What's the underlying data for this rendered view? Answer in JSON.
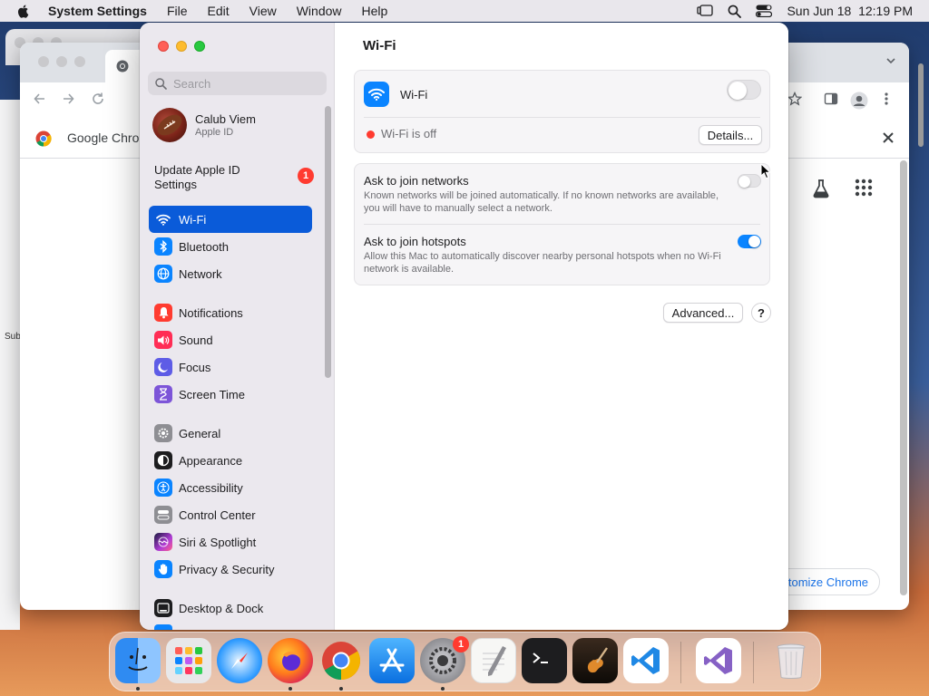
{
  "menubar": {
    "app_name": "System Settings",
    "menus": [
      "File",
      "Edit",
      "View",
      "Window",
      "Help"
    ],
    "clock": "Sun Jun 18  12:19 PM"
  },
  "chrome": {
    "infobar_text": "Google Chrom",
    "customize_text": "tomize Chrome",
    "left_sliver_text": "Sub"
  },
  "settings": {
    "search_placeholder": "Search",
    "account": {
      "name": "Calub Viem",
      "subtitle": "Apple ID"
    },
    "update": {
      "line1": "Update Apple ID",
      "line2": "Settings",
      "badge": "1"
    },
    "nav": [
      {
        "label": "Wi-Fi",
        "icon": "wifi-icon",
        "color": "#0a84ff",
        "selected": true
      },
      {
        "label": "Bluetooth",
        "icon": "bluetooth-icon",
        "color": "#0a84ff"
      },
      {
        "label": "Network",
        "icon": "globe-icon",
        "color": "#0a84ff"
      },
      {
        "label": "Notifications",
        "icon": "bell-icon",
        "color": "#ff3b30"
      },
      {
        "label": "Sound",
        "icon": "speaker-icon",
        "color": "#ff2d55"
      },
      {
        "label": "Focus",
        "icon": "moon-icon",
        "color": "#5e5ce6"
      },
      {
        "label": "Screen Time",
        "icon": "hourglass-icon",
        "color": "#7d55d8"
      },
      {
        "label": "General",
        "icon": "gear-icon",
        "color": "#8e8e93"
      },
      {
        "label": "Appearance",
        "icon": "appearance-icon",
        "color": "#1d1d1f"
      },
      {
        "label": "Accessibility",
        "icon": "accessibility-icon",
        "color": "#0a84ff"
      },
      {
        "label": "Control Center",
        "icon": "control-center-icon",
        "color": "#8e8e93"
      },
      {
        "label": "Siri & Spotlight",
        "icon": "siri-icon",
        "color": "#b03cd6"
      },
      {
        "label": "Privacy & Security",
        "icon": "hand-icon",
        "color": "#0a84ff"
      },
      {
        "label": "Desktop & Dock",
        "icon": "dock-icon",
        "color": "#1d1d1f"
      }
    ],
    "content": {
      "title": "Wi-Fi",
      "wifi_label": "Wi-Fi",
      "wifi_on": false,
      "status_text": "Wi-Fi is off",
      "details_button": "Details...",
      "ask_networks": {
        "title": "Ask to join networks",
        "description": "Known networks will be joined automatically. If no known networks are available, you will have to manually select a network.",
        "on": false
      },
      "ask_hotspots": {
        "title": "Ask to join hotspots",
        "description": "Allow this Mac to automatically discover nearby personal hotspots when no Wi-Fi network is available.",
        "on": true
      },
      "advanced_button": "Advanced...",
      "help_button": "?"
    }
  },
  "dock": {
    "apps": [
      "Finder",
      "Launchpad",
      "Safari",
      "Firefox",
      "Google Chrome",
      "App Store",
      "System Settings",
      "TextEdit",
      "Terminal",
      "GarageBand",
      "Visual Studio Code",
      "Visual Studio",
      "Trash"
    ],
    "settings_badge": "1"
  },
  "colors": {
    "accent": "#0a5bd9",
    "toggle_on": "#0a84ff",
    "status_off": "#ff3b30"
  }
}
